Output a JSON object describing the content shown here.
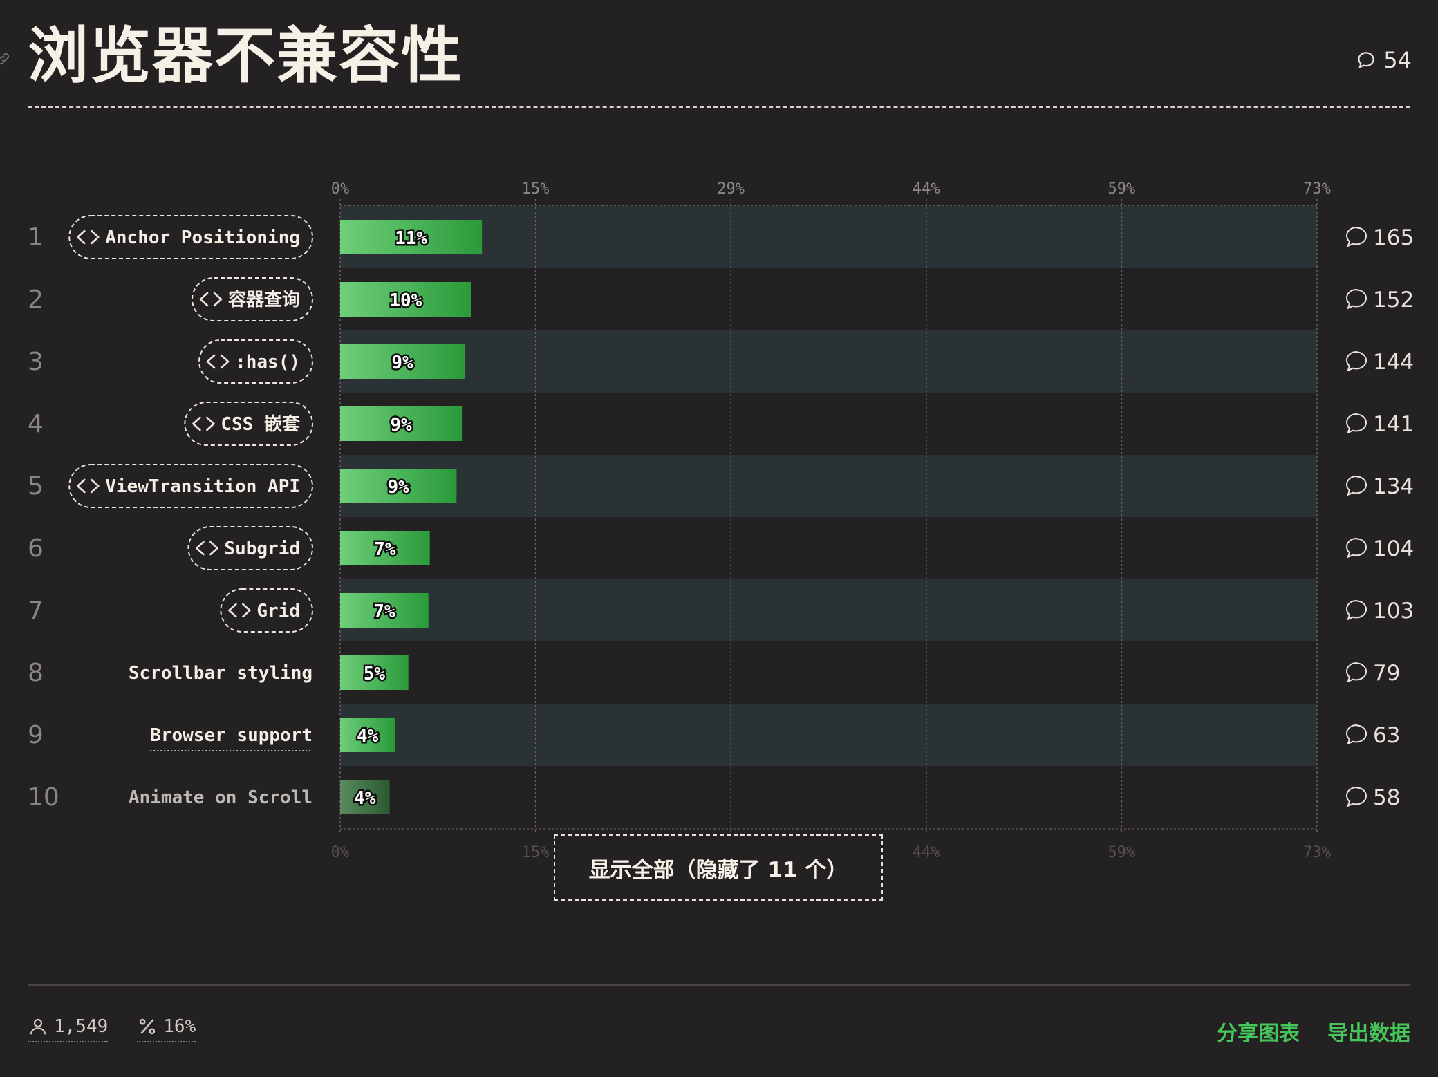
{
  "header": {
    "title": "浏览器不兼容性",
    "comment_count": "54"
  },
  "chart_data": {
    "type": "bar",
    "orientation": "horizontal",
    "title": "浏览器不兼容性",
    "x_ticks": [
      "0%",
      "15%",
      "29%",
      "44%",
      "59%",
      "73%"
    ],
    "xlim": [
      0,
      73
    ],
    "grid": true,
    "categories": [
      "Anchor Positioning",
      "容器查询",
      ":has()",
      "CSS 嵌套",
      "ViewTransition API",
      "Subgrid",
      "Grid",
      "Scrollbar styling",
      "Browser support",
      "Animate on Scroll"
    ],
    "ranks": [
      "1",
      "2",
      "3",
      "4",
      "5",
      "6",
      "7",
      "8",
      "9",
      "10"
    ],
    "values": [
      10.6,
      9.8,
      9.3,
      9.1,
      8.7,
      6.7,
      6.6,
      5.1,
      4.1,
      3.7
    ],
    "value_labels": [
      "11%",
      "10%",
      "9%",
      "9%",
      "9%",
      "7%",
      "7%",
      "5%",
      "4%",
      "4%"
    ],
    "comment_counts": [
      "165",
      "152",
      "144",
      "141",
      "134",
      "104",
      "103",
      "79",
      "63",
      "58"
    ],
    "code_tagged": [
      true,
      true,
      true,
      true,
      true,
      true,
      true,
      false,
      false,
      false
    ],
    "underlined": [
      false,
      false,
      false,
      false,
      false,
      false,
      false,
      false,
      true,
      false
    ],
    "dimmed": [
      false,
      false,
      false,
      false,
      false,
      false,
      false,
      false,
      false,
      true
    ],
    "colors": {
      "bar_start": "#6fcf7a",
      "bar_end": "#2a9a3a",
      "bar_dim_start": "#5a8a5e",
      "bar_dim_end": "#2c5a32",
      "row_band": "#2b3235",
      "background": "#242123"
    }
  },
  "show_all_button": {
    "label": "显示全部（隐藏了 11 个）"
  },
  "footer": {
    "respondents": "1,549",
    "percentage": "16%",
    "share_label": "分享图表",
    "export_label": "导出数据"
  },
  "icons": {
    "comment": "comment-bubble-icon",
    "code": "code-brackets-icon",
    "user": "user-icon",
    "percent": "percent-icon",
    "link": "link-icon"
  }
}
